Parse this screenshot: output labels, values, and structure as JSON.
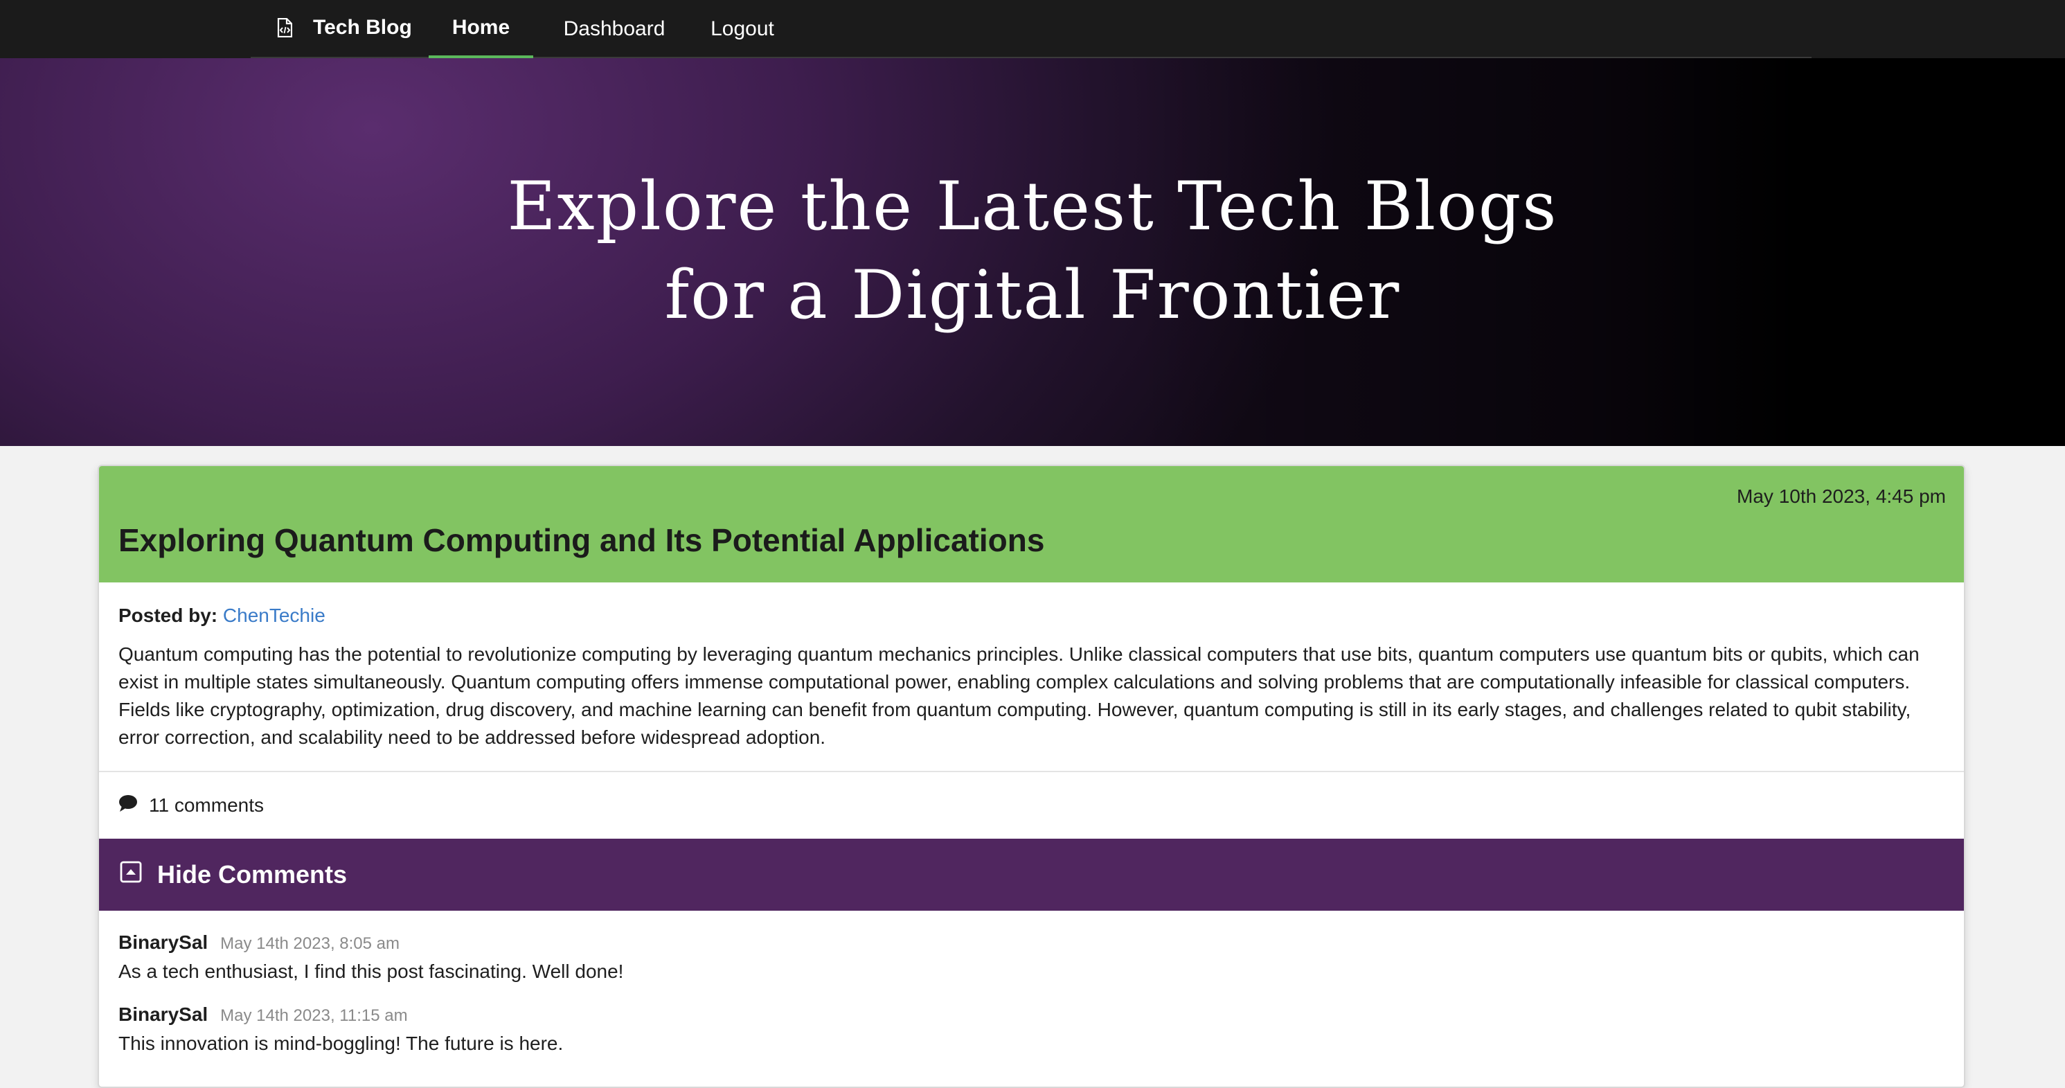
{
  "nav": {
    "brand": "Tech Blog",
    "items": [
      {
        "label": "Home",
        "active": true
      },
      {
        "label": "Dashboard",
        "active": false
      },
      {
        "label": "Logout",
        "active": false
      }
    ]
  },
  "hero": {
    "line1": "Explore the Latest Tech Blogs",
    "line2": "for a Digital Frontier"
  },
  "post": {
    "date": "May 10th 2023, 4:45 pm",
    "title": "Exploring Quantum Computing and Its Potential Applications",
    "posted_by_label": "Posted by:",
    "author": "ChenTechie",
    "body": "Quantum computing has the potential to revolutionize computing by leveraging quantum mechanics principles. Unlike classical computers that use bits, quantum computers use quantum bits or qubits, which can exist in multiple states simultaneously. Quantum computing offers immense computational power, enabling complex calculations and solving problems that are computationally infeasible for classical computers. Fields like cryptography, optimization, drug discovery, and machine learning can benefit from quantum computing. However, quantum computing is still in its early stages, and challenges related to qubit stability, error correction, and scalability need to be addressed before widespread adoption.",
    "comment_count": "11 comments",
    "toggle_label": "Hide Comments",
    "comments": [
      {
        "author": "BinarySal",
        "date": "May 14th 2023, 8:05 am",
        "text": "As a tech enthusiast, I find this post fascinating. Well done!"
      },
      {
        "author": "BinarySal",
        "date": "May 14th 2023, 11:15 am",
        "text": "This innovation is mind-boggling! The future is here."
      }
    ]
  },
  "icons": {
    "brand": "file-code-icon",
    "comment": "comment-bubble-icon",
    "toggle": "collapse-square-icon"
  },
  "colors": {
    "header_bg": "#82c462",
    "accent_purple": "#50265f",
    "link": "#3a7bc8",
    "nav_active": "#5cb85c"
  }
}
